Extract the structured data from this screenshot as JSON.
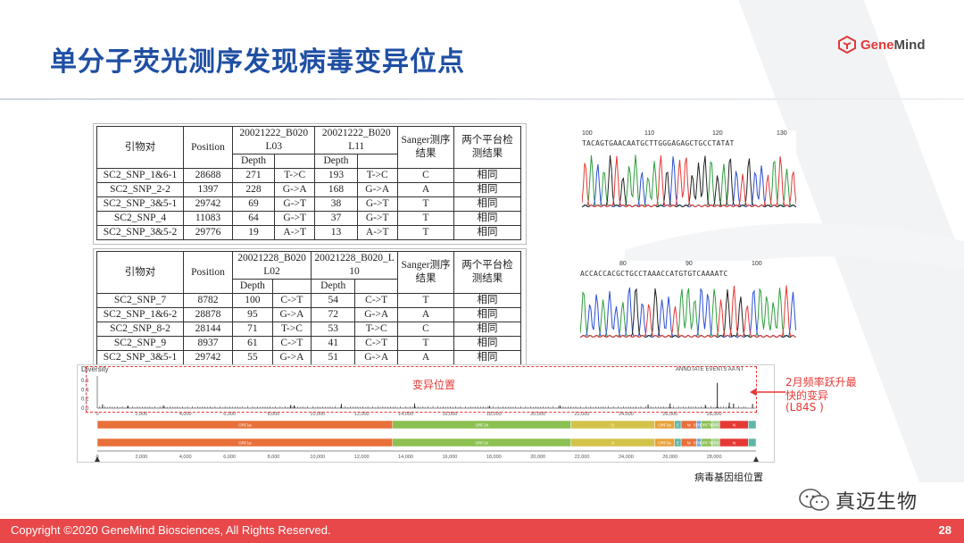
{
  "slide": {
    "title": "单分子荧光测序发现病毒变异位点",
    "logo_text_a": "Gene",
    "logo_text_b": "Mind",
    "page_number": "28",
    "copyright": "Copyright ©2020 GeneMind Biosciences, All Rights Reserved.",
    "wechat_name": "真迈生物"
  },
  "table1": {
    "headers": {
      "primer": "引物对",
      "position": "Position",
      "sample_a": "20021222_B020 L03",
      "sample_b": "20021222_B020 L11",
      "depth": "Depth",
      "sanger": "Sanger测序结果",
      "agree": "两个平台检测结果"
    },
    "rows": [
      {
        "primer": "SC2_SNP_1&6-1",
        "pos": "28688",
        "da": "271",
        "ma": "T->C",
        "db": "193",
        "mb": "T->C",
        "sanger": "C",
        "agree": "相同"
      },
      {
        "primer": "SC2_SNP_2-2",
        "pos": "1397",
        "da": "228",
        "ma": "G->A",
        "db": "168",
        "mb": "G->A",
        "sanger": "A",
        "agree": "相同"
      },
      {
        "primer": "SC2_SNP_3&5-1",
        "pos": "29742",
        "da": "69",
        "ma": "G->T",
        "db": "38",
        "mb": "G->T",
        "sanger": "T",
        "agree": "相同"
      },
      {
        "primer": "SC2_SNP_4",
        "pos": "11083",
        "da": "64",
        "ma": "G->T",
        "db": "37",
        "mb": "G->T",
        "sanger": "T",
        "agree": "相同"
      },
      {
        "primer": "SC2_SNP_3&5-2",
        "pos": "29776",
        "da": "19",
        "ma": "A->T",
        "db": "13",
        "mb": "A->T",
        "sanger": "T",
        "agree": "相同"
      }
    ]
  },
  "table2": {
    "headers": {
      "primer": "引物对",
      "position": "Position",
      "sample_a": "20021228_B020 L02",
      "sample_b": "20021228_B020_L 10",
      "depth": "Depth",
      "sanger": "Sanger测序结果",
      "agree": "两个平台检测结果"
    },
    "rows": [
      {
        "primer": "SC2_SNP_7",
        "pos": "8782",
        "da": "100",
        "ma": "C->T",
        "db": "54",
        "mb": "C->T",
        "sanger": "T",
        "agree": "相同"
      },
      {
        "primer": "SC2_SNP_1&6-2",
        "pos": "28878",
        "da": "95",
        "ma": "G->A",
        "db": "72",
        "mb": "G->A",
        "sanger": "A",
        "agree": "相同"
      },
      {
        "primer": "SC2_SNP_8-2",
        "pos": "28144",
        "da": "71",
        "ma": "T->C",
        "db": "53",
        "mb": "T->C",
        "sanger": "C",
        "agree": "相同"
      },
      {
        "primer": "SC2_SNP_9",
        "pos": "8937",
        "da": "61",
        "ma": "C->T",
        "db": "41",
        "mb": "C->T",
        "sanger": "T",
        "agree": "相同"
      },
      {
        "primer": "SC2_SNP_3&5-1",
        "pos": "29742",
        "da": "55",
        "ma": "G->A",
        "db": "51",
        "mb": "G->A",
        "sanger": "A",
        "agree": "相同"
      }
    ]
  },
  "chromatogram1": {
    "ticks": [
      "100",
      "110",
      "120",
      "130"
    ],
    "sequence": "TACAGTGAACAATGCTTGGGAGAGCTGCCTATAT"
  },
  "chromatogram2": {
    "ticks": [
      "80",
      "90",
      "100"
    ],
    "sequence": "ACCACCACGCTGCCTAAACCATGTGTCAAAATC"
  },
  "genome_plot": {
    "ylabel": "Diversity",
    "y_ticks": [
      "0.6",
      "0.4",
      "0.2",
      "0.0"
    ],
    "x_ticks": [
      "0",
      "2,000",
      "4,000",
      "6,000",
      "8,000",
      "10,000",
      "12,000",
      "14,000",
      "16,000",
      "18,000",
      "20,000",
      "22,000",
      "24,000",
      "26,000",
      "28,000"
    ],
    "genes": [
      {
        "name": "ORF1a",
        "start": 0,
        "end": 13400,
        "color": "#e8703a"
      },
      {
        "name": "ORF1b",
        "start": 13400,
        "end": 21500,
        "color": "#8cc152"
      },
      {
        "name": "S",
        "start": 21500,
        "end": 25300,
        "color": "#d4c34a"
      },
      {
        "name": "ORF3a",
        "start": 25300,
        "end": 26200,
        "color": "#e8a23a"
      },
      {
        "name": "E",
        "start": 26200,
        "end": 26500,
        "color": "#5fb6a8"
      },
      {
        "name": "M",
        "start": 26500,
        "end": 27200,
        "color": "#e8703a"
      },
      {
        "name": "ORF6",
        "start": 27200,
        "end": 27400,
        "color": "#6fa8dc"
      },
      {
        "name": "ORF7a",
        "start": 27400,
        "end": 27900,
        "color": "#8cc152"
      },
      {
        "name": "ORF8",
        "start": 27900,
        "end": 28250,
        "color": "#a9d18e"
      },
      {
        "name": "N",
        "start": 28250,
        "end": 29550,
        "color": "#e53935"
      },
      {
        "name": "",
        "start": 29550,
        "end": 29900,
        "color": "#5fb6a8"
      }
    ],
    "top_controls": "ANNOTATE   EVENTS   AA   NT",
    "peaks": [
      [
        240,
        0.08
      ],
      [
        1397,
        0.05
      ],
      [
        3000,
        0.06
      ],
      [
        8782,
        0.07
      ],
      [
        8937,
        0.06
      ],
      [
        11083,
        0.09
      ],
      [
        14400,
        0.1
      ],
      [
        17800,
        0.05
      ],
      [
        21000,
        0.06
      ],
      [
        25000,
        0.08
      ],
      [
        26000,
        0.1
      ],
      [
        27600,
        0.07
      ],
      [
        28144,
        0.55
      ],
      [
        28688,
        0.12
      ],
      [
        28878,
        0.1
      ],
      [
        29742,
        0.09
      ]
    ]
  },
  "annotations": {
    "variant_positions": "变异位置",
    "fast_variant_1": "2月频率跃升最",
    "fast_variant_2": "快的变异",
    "fast_variant_3": "(L84S )",
    "axis_caption": "病毒基因组位置"
  }
}
